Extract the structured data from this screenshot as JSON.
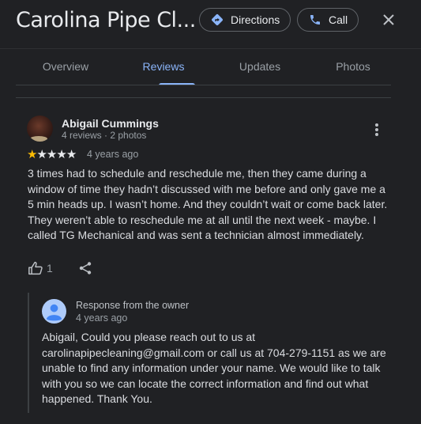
{
  "header": {
    "title": "Carolina Pipe Cl...",
    "directions_label": "Directions",
    "call_label": "Call",
    "icons": {
      "directions": "directions-diamond-icon",
      "call": "phone-icon",
      "close": "close-icon"
    },
    "accent_color": "#8ab4f8"
  },
  "tabs": [
    {
      "label": "Overview",
      "active": false
    },
    {
      "label": "Reviews",
      "active": true
    },
    {
      "label": "Updates",
      "active": false
    },
    {
      "label": "Photos",
      "active": false
    }
  ],
  "review": {
    "author": "Abigail Cummings",
    "author_meta": "4 reviews · 2 photos",
    "rating": 1,
    "max_rating": 5,
    "date": "4 years ago",
    "text": "3 times had to schedule and reschedule me, then they came during a window of time they hadn’t discussed with me before and only gave me a 5 min heads up. I wasn’t home. And they couldn’t wait or come back later. They weren’t able to reschedule me at all until the next week - maybe. I called TG Mechanical and was sent a technician almost immediately.",
    "likes": "1",
    "star_color": "#fbbc04"
  },
  "owner_response": {
    "title": "Response from the owner",
    "date": "4 years ago",
    "text": "Abigail, Could you please reach out to us at carolinapipecleaning@gmail.com or call us at 704-279-1151 as we are unable to find any information under your name. We would like to talk with you so we can locate the correct information and find out what happened. Thank You."
  }
}
